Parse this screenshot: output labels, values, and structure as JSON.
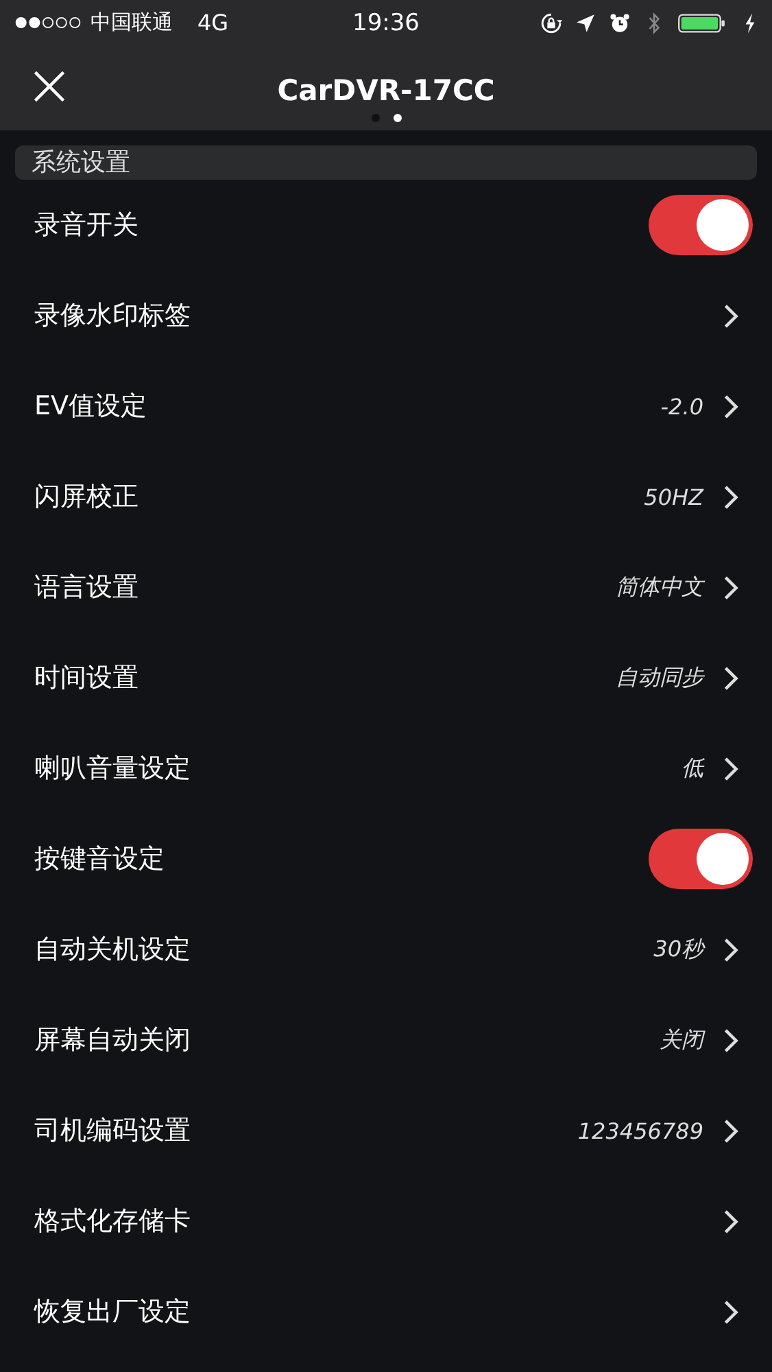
{
  "status_bar": {
    "carrier": "中国联通",
    "network": "4G",
    "time": "19:36"
  },
  "nav": {
    "title": "CarDVR-17CC",
    "pages": [
      {
        "selected": false
      },
      {
        "selected": true
      }
    ]
  },
  "section": {
    "title": "系统设置"
  },
  "rows": [
    {
      "kind": "toggle",
      "label": "录音开关",
      "on": true
    },
    {
      "kind": "link",
      "label": "录像水印标签"
    },
    {
      "kind": "link",
      "label": "EV值设定",
      "value": "-2.0"
    },
    {
      "kind": "link",
      "label": "闪屏校正",
      "value": "50HZ"
    },
    {
      "kind": "link",
      "label": "语言设置",
      "value": "简体中文"
    },
    {
      "kind": "link",
      "label": "时间设置",
      "value": "自动同步"
    },
    {
      "kind": "link",
      "label": "喇叭音量设定",
      "value": "低"
    },
    {
      "kind": "toggle",
      "label": "按键音设定",
      "on": true
    },
    {
      "kind": "link",
      "label": "自动关机设定",
      "value": "30秒"
    },
    {
      "kind": "link",
      "label": "屏幕自动关闭",
      "value": "关闭"
    },
    {
      "kind": "link",
      "label": "司机编码设置",
      "value": "123456789"
    },
    {
      "kind": "link",
      "label": "格式化存储卡"
    },
    {
      "kind": "link",
      "label": "恢复出厂设定"
    }
  ]
}
